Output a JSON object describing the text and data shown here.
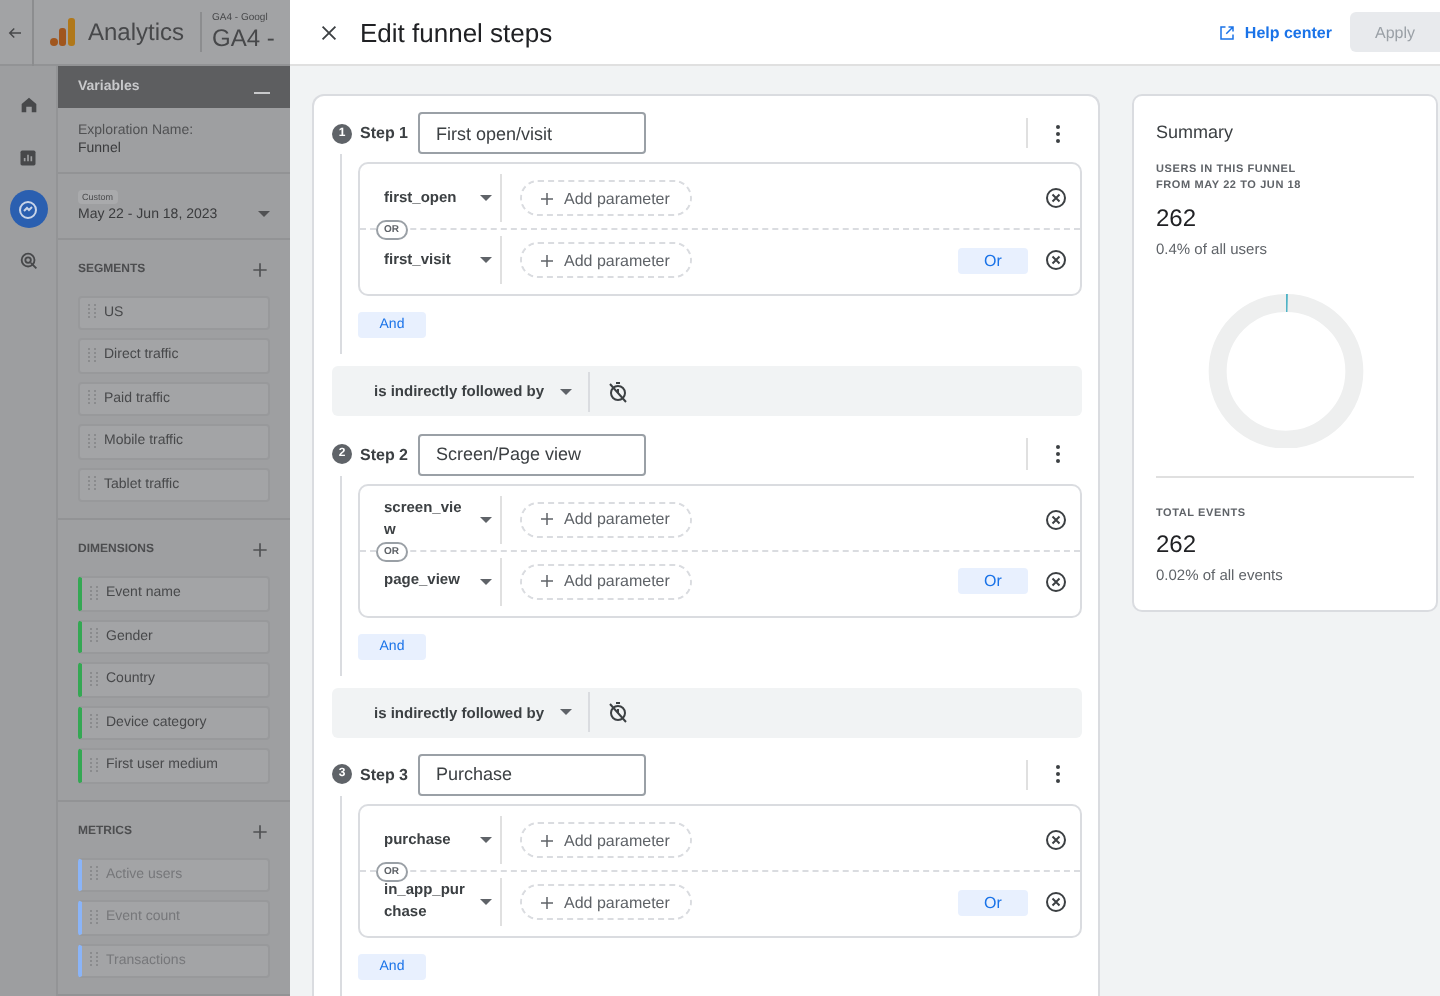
{
  "app_bar": {
    "product": "Analytics",
    "account_small": "GA4 - Googl",
    "account": "GA4 -"
  },
  "rail": [
    {
      "selected": false
    },
    {
      "selected": false
    },
    {
      "selected": true
    },
    {
      "selected": false
    }
  ],
  "variables": {
    "title": "Variables",
    "exploration_label": "Exploration Name:",
    "exploration_name": "Funnel",
    "date_chip": "Custom",
    "date_range": "May 22 - Jun 18, 2023",
    "sections": [
      {
        "title": "SEGMENTS",
        "disabled": false,
        "items": [
          "US",
          "Direct traffic",
          "Paid traffic",
          "Mobile traffic",
          "Tablet traffic"
        ]
      },
      {
        "title": "DIMENSIONS",
        "color": "#34a853",
        "disabled": false,
        "items": [
          "Event name",
          "Gender",
          "Country",
          "Device category",
          "First user medium"
        ]
      },
      {
        "title": "METRICS",
        "color": "#8ab4f8",
        "disabled": true,
        "items": [
          "Active users",
          "Event count",
          "Transactions"
        ]
      }
    ]
  },
  "dialog": {
    "title": "Edit funnel steps",
    "help": "Help center",
    "apply": {
      "label": "Apply",
      "disabled": true
    }
  },
  "flow": [
    {
      "kind": "step",
      "number": "1",
      "label": "Step 1",
      "name": "First open/visit",
      "or_chip": "OR",
      "and_button": "And",
      "conditions": [
        {
          "event": "first_open",
          "add_parameter": "Add parameter"
        },
        {
          "event": "first_visit",
          "add_parameter": "Add parameter",
          "or_button": "Or"
        }
      ]
    },
    {
      "kind": "connector",
      "label": "is indirectly followed by"
    },
    {
      "kind": "step",
      "number": "2",
      "label": "Step 2",
      "name": "Screen/Page view",
      "or_chip": "OR",
      "and_button": "And",
      "conditions": [
        {
          "event": "screen_view",
          "add_parameter": "Add parameter"
        },
        {
          "event": "page_view",
          "add_parameter": "Add parameter",
          "or_button": "Or"
        }
      ]
    },
    {
      "kind": "connector",
      "label": "is indirectly followed by"
    },
    {
      "kind": "step",
      "number": "3",
      "label": "Step 3",
      "name": "Purchase",
      "or_chip": "OR",
      "and_button": "And",
      "conditions": [
        {
          "event": "purchase",
          "add_parameter": "Add parameter"
        },
        {
          "event": "in_app_purchase",
          "add_parameter": "Add parameter",
          "or_button": "Or"
        }
      ]
    }
  ],
  "summary": {
    "title": "Summary",
    "users_label": "USERS IN THIS FUNNEL",
    "users_range": "FROM MAY 22 TO JUN 18",
    "users_value": "262",
    "users_share": "0.4% of all users",
    "level": 0.004,
    "events_label": "TOTAL EVENTS",
    "events_value": "262",
    "events_share": "0.02% of all events"
  }
}
